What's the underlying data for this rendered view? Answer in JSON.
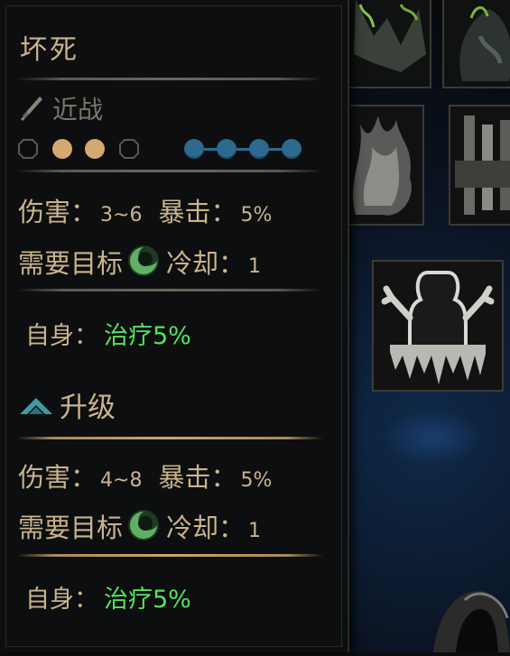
{
  "skill": {
    "name": "坏死",
    "type_label": "近战",
    "rank_positions": [
      false,
      true,
      true,
      false
    ],
    "target_positions": [
      true,
      true,
      true,
      true
    ],
    "target_linked": true
  },
  "base": {
    "damage_label": "伤害：",
    "damage_value": "3~6",
    "crit_label": "暴击：",
    "crit_value": "5%",
    "need_target_label": "需要目标",
    "cooldown_label": "冷却：",
    "cooldown_value": "1",
    "self_label": "自身：",
    "self_effect": "治疗5%"
  },
  "upgrade": {
    "label": "升级",
    "damage_label": "伤害：",
    "damage_value": "4~8",
    "crit_label": "暴击：",
    "crit_value": "5%",
    "need_target_label": "需要目标",
    "cooldown_label": "冷却：",
    "cooldown_value": "1",
    "self_label": "自身：",
    "self_effect": "治疗5%"
  },
  "colors": {
    "text": "#c9b48c",
    "muted": "#7a7468",
    "heal": "#52e35c",
    "target": "#2d6a90",
    "rank_filled": "#d4a872",
    "upgrade_icon": "#3f9aa6"
  }
}
